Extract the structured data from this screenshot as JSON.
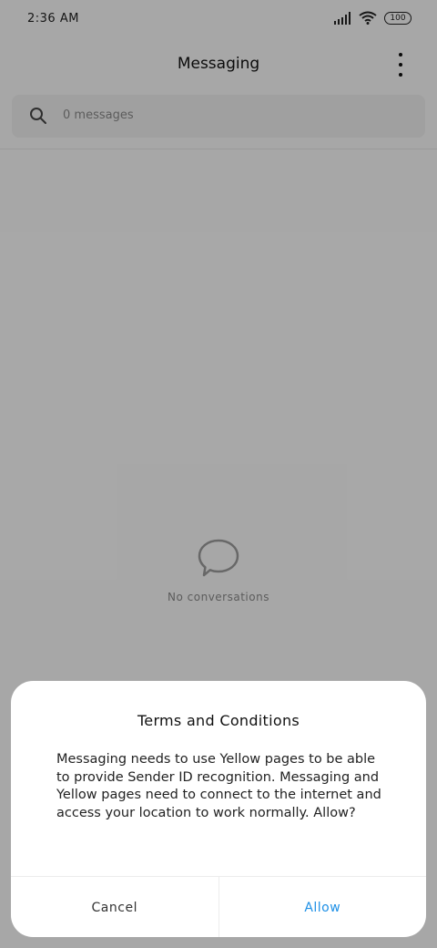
{
  "status_bar": {
    "time": "2:36 AM",
    "battery": "100"
  },
  "header": {
    "title": "Messaging"
  },
  "search": {
    "placeholder": "0 messages"
  },
  "empty_state": {
    "text": "No conversations"
  },
  "dialog": {
    "title": "Terms and Conditions",
    "body": "Messaging needs to use Yellow pages to be able to provide Sender ID recognition. Messaging and Yellow pages need to connect to the internet and access your location to work normally. Allow?",
    "cancel_label": "Cancel",
    "allow_label": "Allow"
  },
  "colors": {
    "accent": "#1e90e6",
    "scrim": "rgba(0,0,0,0.32)"
  },
  "icons": [
    "signal-icon",
    "wifi-icon",
    "battery-icon",
    "more-options-icon",
    "search-icon",
    "chat-bubble-icon"
  ]
}
